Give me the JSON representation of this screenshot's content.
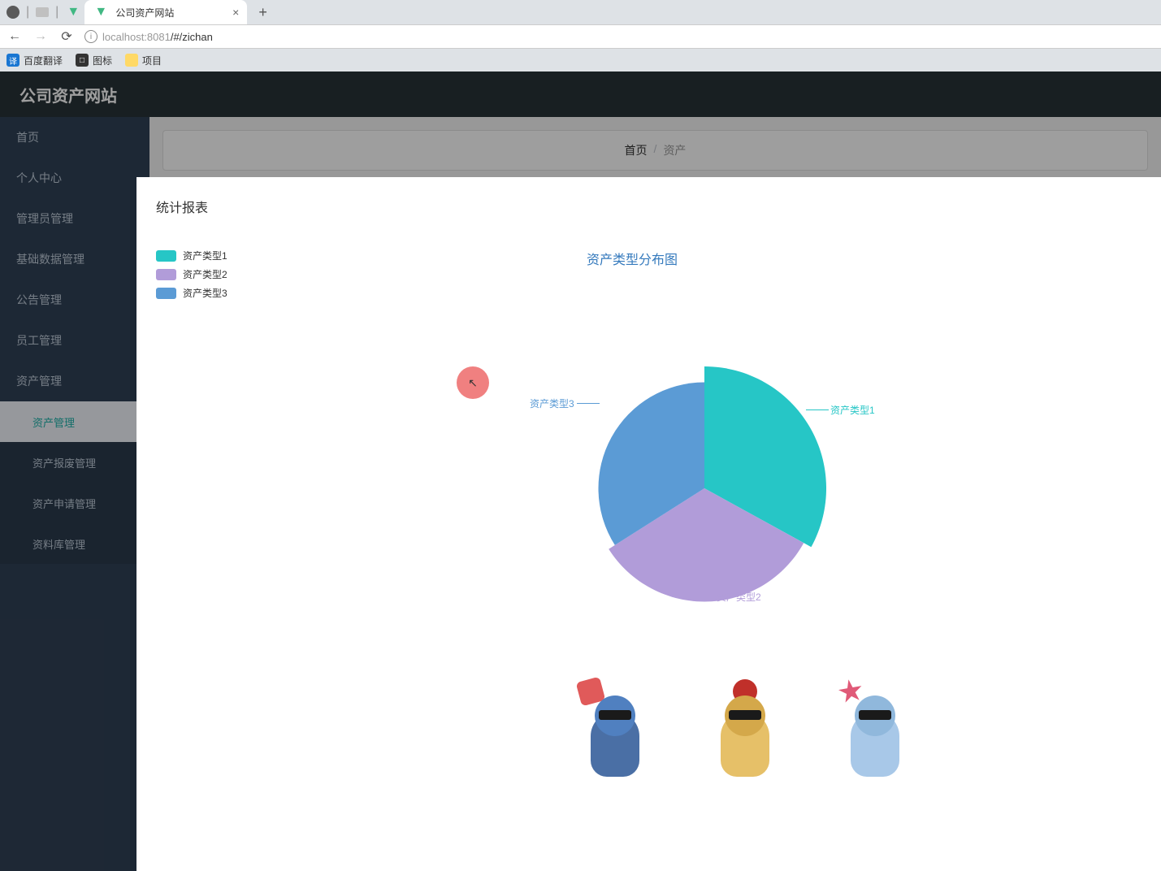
{
  "tab_title": "公司资产网站",
  "url_host": "localhost:8081",
  "url_path": "/#/zichan",
  "bookmarks": [
    {
      "label": "百度翻译"
    },
    {
      "label": "图标"
    },
    {
      "label": "项目"
    }
  ],
  "app_title": "公司资产网站",
  "sidebar": {
    "items": [
      {
        "label": "首页"
      },
      {
        "label": "个人中心"
      },
      {
        "label": "管理员管理"
      },
      {
        "label": "基础数据管理"
      },
      {
        "label": "公告管理"
      },
      {
        "label": "员工管理"
      },
      {
        "label": "资产管理"
      }
    ],
    "sub_items": [
      {
        "label": "资产管理"
      },
      {
        "label": "资产报废管理"
      },
      {
        "label": "资产申请管理"
      },
      {
        "label": "资料库管理"
      }
    ]
  },
  "breadcrumb": {
    "home": "首页",
    "sep": "/",
    "current": "资产"
  },
  "modal_title": "统计报表",
  "chart_data": {
    "type": "pie",
    "title": "资产类型分布图",
    "series": [
      {
        "name": "资产类型1",
        "value": 33,
        "color": "#26c6c6",
        "radius_pct": 100
      },
      {
        "name": "资产类型2",
        "value": 33,
        "color": "#b19cd9",
        "radius_pct": 93
      },
      {
        "name": "资产类型3",
        "value": 34,
        "color": "#5b9bd5",
        "radius_pct": 87
      }
    ],
    "legend_position": "top-left",
    "rose": true
  }
}
